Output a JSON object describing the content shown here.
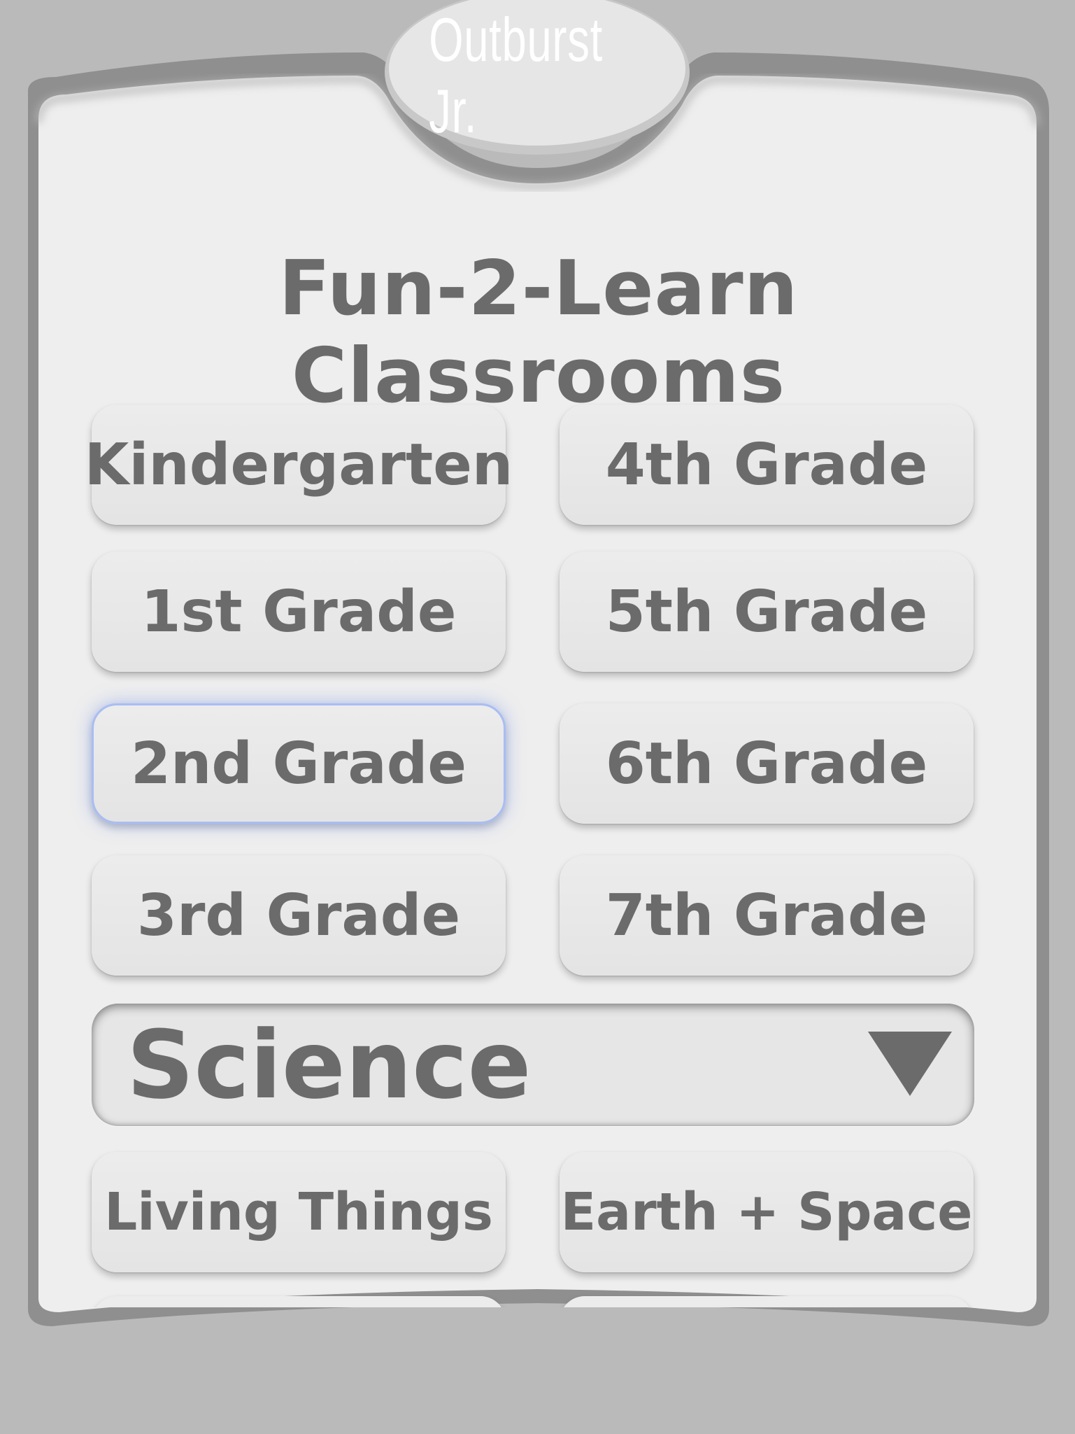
{
  "app": {
    "brand": "Outburst Jr.",
    "title": "Fun-2-Learn Classrooms"
  },
  "grades": [
    {
      "label": "Kindergarten"
    },
    {
      "label": "4th Grade"
    },
    {
      "label": "1st Grade"
    },
    {
      "label": "5th Grade"
    },
    {
      "label": "2nd Grade",
      "focused": true
    },
    {
      "label": "6th Grade"
    },
    {
      "label": "3rd Grade"
    },
    {
      "label": "7th Grade"
    }
  ],
  "subject_dropdown": {
    "selected": "Science"
  },
  "topics": [
    {
      "label": "Living Things"
    },
    {
      "label": "Earth + Space"
    }
  ],
  "colors": {
    "background": "#bababa",
    "panel": "#eeeeee",
    "frame": "#8f8f8f",
    "button": "#e8e8e8",
    "text": "#6b6b6b",
    "focus_glow": "#a9bdf2",
    "brand_text": "#ffffff"
  },
  "icons": {
    "dropdown_arrow": "triangle-down-icon"
  }
}
